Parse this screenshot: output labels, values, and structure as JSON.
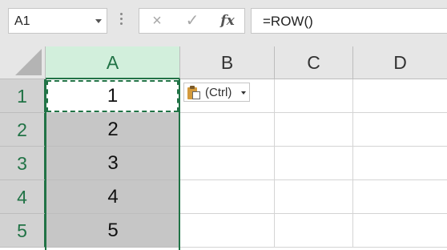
{
  "name_box": {
    "value": "A1"
  },
  "formula_bar": {
    "cancel_icon": "×",
    "enter_icon": "✓",
    "fx_label": "fx",
    "formula": "=ROW()"
  },
  "columns": [
    {
      "label": "A",
      "selected": true
    },
    {
      "label": "B",
      "selected": false
    },
    {
      "label": "C",
      "selected": false
    },
    {
      "label": "D",
      "selected": false
    }
  ],
  "rows": [
    {
      "label": "1",
      "a": "1"
    },
    {
      "label": "2",
      "a": "2"
    },
    {
      "label": "3",
      "a": "3"
    },
    {
      "label": "4",
      "a": "4"
    },
    {
      "label": "5",
      "a": "5"
    }
  ],
  "paste_options": {
    "label": "(Ctrl)"
  },
  "colors": {
    "accent": "#217346",
    "selection_fill": "#c6c6c6",
    "header_selected": "#d2efdc"
  }
}
